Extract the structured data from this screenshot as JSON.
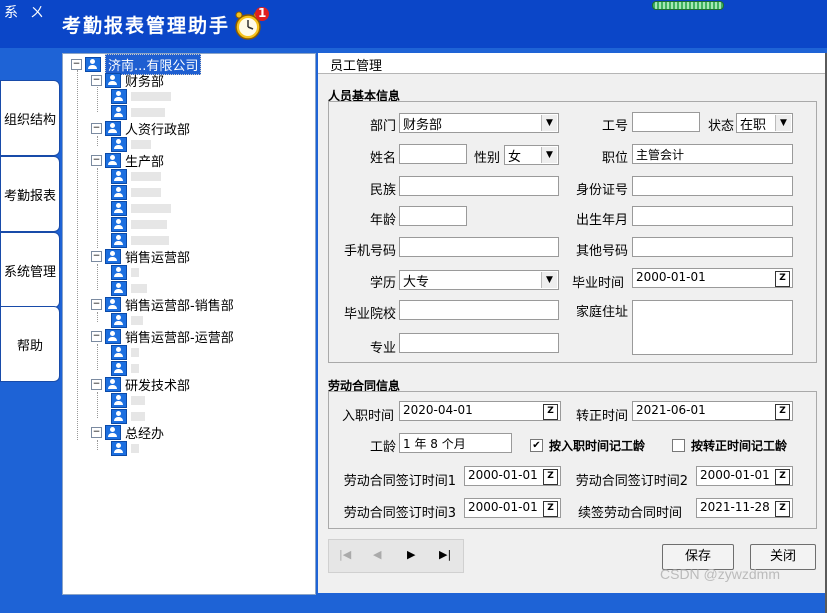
{
  "window": {
    "glyphs": [
      "系",
      "ㄨ"
    ],
    "title": "考勤报表管理助手",
    "notification_count": "1"
  },
  "side_tabs": [
    "组织结构",
    "考勤报表",
    "系统管理",
    "帮助"
  ],
  "tree": {
    "root": "济南...有限公司",
    "departments": [
      "财务部",
      "人资行政部",
      "生产部",
      "销售运营部",
      "销售运营部-销售部",
      "销售运营部-运营部",
      "研发技术部",
      "总经办"
    ]
  },
  "panel": {
    "title": "员工管理",
    "basic_section": "人员基本信息",
    "contract_section": "劳动合同信息",
    "fields": {
      "dept_label": "部门",
      "dept_value": "财务部",
      "empno_label": "工号",
      "empno_value": "",
      "status_label": "状态",
      "status_value": "在职",
      "name_label": "姓名",
      "name_value": "",
      "gender_label": "性别",
      "gender_value": "女",
      "position_label": "职位",
      "position_value": "主管会计",
      "ethnic_label": "民族",
      "ethnic_value": "",
      "idcard_label": "身份证号",
      "idcard_value": "",
      "age_label": "年龄",
      "age_value": "",
      "birth_label": "出生年月",
      "birth_value": "",
      "mobile_label": "手机号码",
      "mobile_value": "",
      "other_phone_label": "其他号码",
      "other_phone_value": "",
      "edu_label": "学历",
      "edu_value": "大专",
      "grad_time_label": "毕业时间",
      "grad_time_value": "2000-01-01",
      "school_label": "毕业院校",
      "school_value": "",
      "address_label": "家庭住址",
      "address_value": "",
      "major_label": "专业",
      "major_value": ""
    },
    "contract": {
      "hire_label": "入职时间",
      "hire_value": "2020-04-01",
      "regular_label": "转正时间",
      "regular_value": "2021-06-01",
      "seniority_label": "工龄",
      "seniority_value": "1 年 8 个月",
      "by_hire_label": "按入职时间记工龄",
      "by_hire_checked": true,
      "by_regular_label": "按转正时间记工龄",
      "by_regular_checked": false,
      "sign1_label": "劳动合同签订时间1",
      "sign1_value": "2000-01-01",
      "sign2_label": "劳动合同签订时间2",
      "sign2_value": "2000-01-01",
      "sign3_label": "劳动合同签订时间3",
      "sign3_value": "2000-01-01",
      "renew_label": "续签劳动合同时间",
      "renew_value": "2021-11-28"
    },
    "buttons": {
      "save": "保存",
      "close": "关闭"
    },
    "nav_glyphs": [
      "|◀",
      "◀",
      "▶",
      "▶|"
    ]
  },
  "watermark": "CSDN @zywzdmm",
  "colors": {
    "titlebar": "#0b46c8",
    "background": "#1e63d6",
    "selection": "#1f5fd1"
  }
}
